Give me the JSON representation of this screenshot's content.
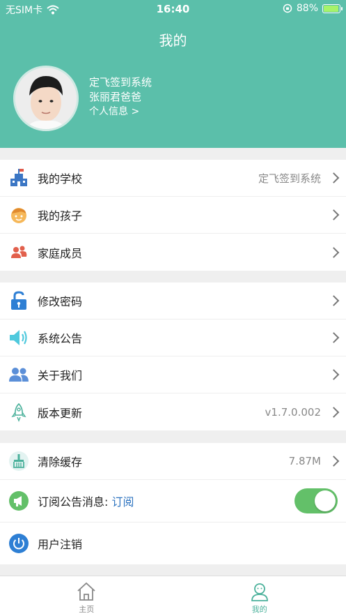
{
  "status_bar": {
    "carrier": "无SIM卡",
    "time": "16:40",
    "battery": "88%"
  },
  "header": {
    "title": "我的"
  },
  "profile": {
    "school": "定飞签到系统",
    "name": "张丽君爸爸",
    "info_link": "个人信息 >"
  },
  "menu": {
    "group1": [
      {
        "label": "我的学校",
        "value": "定飞签到系统",
        "icon": "school-icon"
      },
      {
        "label": "我的孩子",
        "value": "",
        "icon": "child-icon"
      },
      {
        "label": "家庭成员",
        "value": "",
        "icon": "family-icon"
      }
    ],
    "group2": [
      {
        "label": "修改密码",
        "value": "",
        "icon": "lock-icon"
      },
      {
        "label": "系统公告",
        "value": "",
        "icon": "speaker-icon"
      },
      {
        "label": "关于我们",
        "value": "",
        "icon": "people-icon"
      },
      {
        "label": "版本更新",
        "value": "v1.7.0.002",
        "icon": "rocket-icon"
      }
    ],
    "group3": {
      "clear_cache": {
        "label": "清除缓存",
        "value": "7.87M",
        "icon": "broom-icon"
      },
      "subscribe": {
        "label": "订阅公告消息:",
        "status": "订阅",
        "enabled": true,
        "icon": "megaphone-icon"
      },
      "logout": {
        "label": "用户注销",
        "icon": "power-icon"
      }
    }
  },
  "tabbar": {
    "home": "主页",
    "mine": "我的"
  },
  "colors": {
    "primary": "#5bbfaa",
    "toggle_on": "#63c069",
    "link": "#2f74c0"
  }
}
